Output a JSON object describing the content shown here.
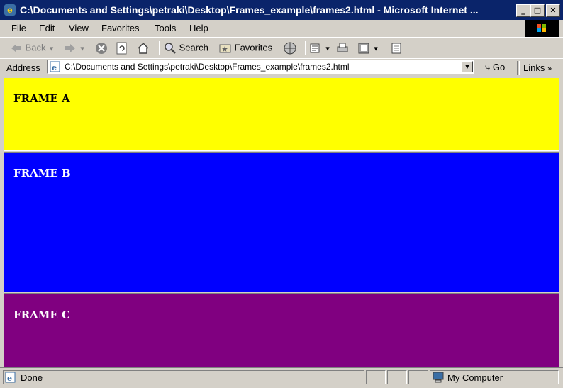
{
  "window": {
    "title": "C:\\Documents and Settings\\petraki\\Desktop\\Frames_example\\frames2.html - Microsoft Internet ...",
    "controls": {
      "minimize": "_",
      "maximize": "□",
      "close": "✕"
    }
  },
  "menu": [
    "File",
    "Edit",
    "View",
    "Favorites",
    "Tools",
    "Help"
  ],
  "toolbar": {
    "back": "Back",
    "search": "Search",
    "favorites": "Favorites"
  },
  "address": {
    "label": "Address",
    "url": "C:\\Documents and Settings\\petraki\\Desktop\\Frames_example\\frames2.html",
    "go": "Go",
    "links": "Links"
  },
  "frames": [
    {
      "label": "FRAME A",
      "bg": "#ffff00",
      "fg": "#000000"
    },
    {
      "label": "FRAME B",
      "bg": "#0000ff",
      "fg": "#ffffff"
    },
    {
      "label": "FRAME C",
      "bg": "#800080",
      "fg": "#ffffff"
    }
  ],
  "status": {
    "text": "Done",
    "zone": "My Computer"
  }
}
